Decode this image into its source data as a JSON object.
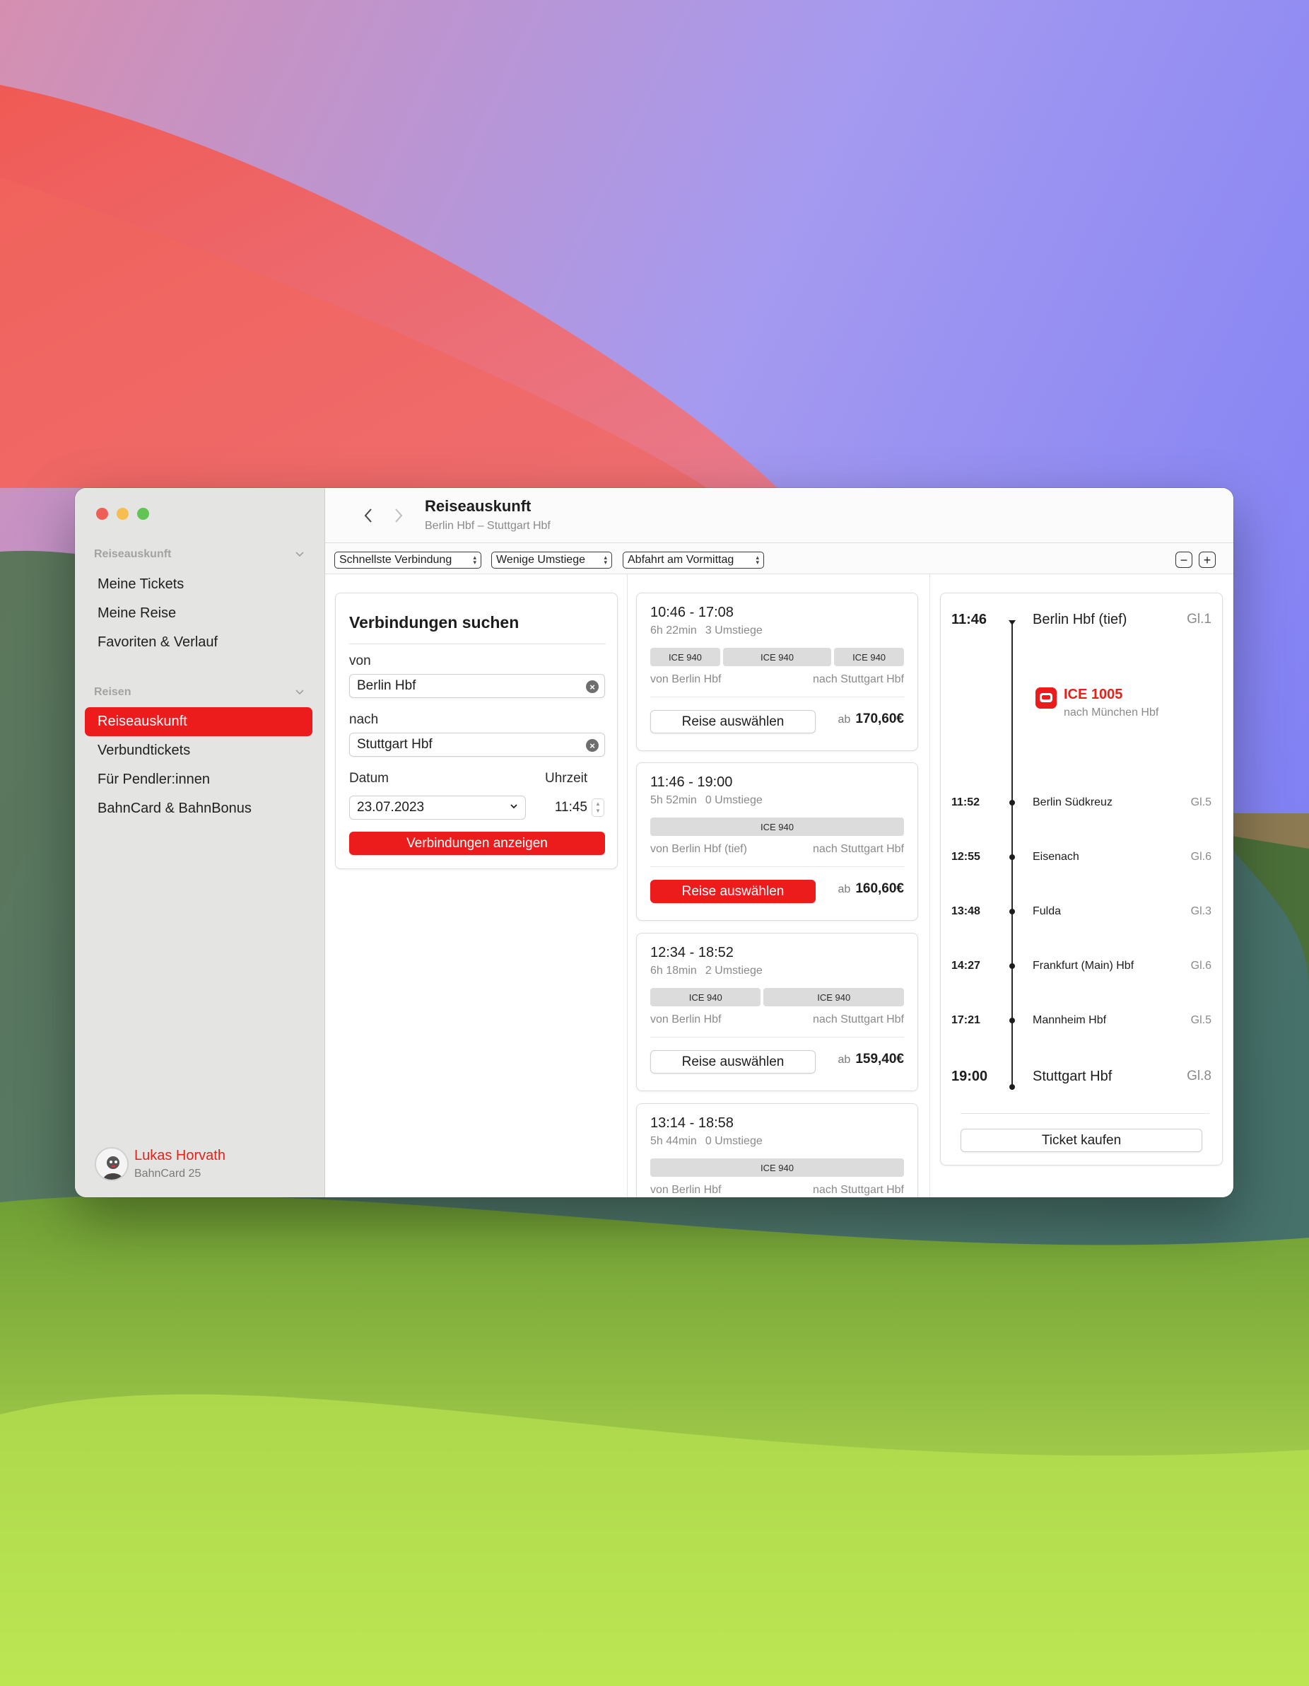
{
  "sidebar": {
    "sections": [
      {
        "title": "Reiseauskunft",
        "items": [
          "Meine Tickets",
          "Meine Reise",
          "Favoriten & Verlauf"
        ]
      },
      {
        "title": "Reisen",
        "items": [
          "Reiseauskunft",
          "Verbundtickets",
          "Für Pendler:innen",
          "BahnCard & BahnBonus"
        ]
      }
    ],
    "active_item": "Reiseauskunft",
    "user": {
      "name": "Lukas Horvath",
      "subtitle": "BahnCard 25"
    }
  },
  "header": {
    "title": "Reiseauskunft",
    "subtitle": "Berlin Hbf – Stuttgart Hbf"
  },
  "filters": [
    "Schnellste Verbindung",
    "Wenige Umstiege",
    "Abfahrt am Vormittag"
  ],
  "search": {
    "title": "Verbindungen suchen",
    "from_label": "von",
    "from_value": "Berlin Hbf",
    "to_label": "nach",
    "to_value": "Stuttgart Hbf",
    "date_label": "Datum",
    "date_value": "23.07.2023",
    "time_label": "Uhrzeit",
    "time_value": "11:45",
    "submit_label": "Verbindungen anzeigen"
  },
  "connections": [
    {
      "time": "10:46 - 17:08",
      "duration": "6h 22min",
      "changes": "3 Umstiege",
      "trains": [
        "ICE 940",
        "ICE 940",
        "ICE 940"
      ],
      "from": "von Berlin Hbf",
      "to": "nach Stuttgart Hbf",
      "button": "Reise auswählen",
      "price_prefix": "ab",
      "price": "170,60€"
    },
    {
      "time": "11:46 - 19:00",
      "duration": "5h 52min",
      "changes": "0 Umstiege",
      "trains": [
        "ICE 940"
      ],
      "from": "von Berlin Hbf (tief)",
      "to": "nach Stuttgart Hbf",
      "button": "Reise auswählen",
      "price_prefix": "ab",
      "price": "160,60€"
    },
    {
      "time": "12:34 - 18:52",
      "duration": "6h 18min",
      "changes": "2 Umstiege",
      "trains": [
        "ICE 940",
        "ICE 940"
      ],
      "from": "von Berlin Hbf",
      "to": "nach Stuttgart Hbf",
      "button": "Reise auswählen",
      "price_prefix": "ab",
      "price": "159,40€"
    },
    {
      "time": "13:14 - 18:58",
      "duration": "5h 44min",
      "changes": "0 Umstiege",
      "trains": [
        "ICE 940"
      ],
      "from": "von Berlin Hbf",
      "to": "nach Stuttgart Hbf"
    }
  ],
  "selected_connection": 1,
  "detail": {
    "train": "ICE 1005",
    "train_direction": "nach München Hbf",
    "stops": [
      {
        "time": "11:46",
        "name": "Berlin Hbf (tief)",
        "platform": "Gl.1"
      },
      {
        "time": "11:52",
        "name": "Berlin Südkreuz",
        "platform": "Gl.5"
      },
      {
        "time": "12:55",
        "name": "Eisenach",
        "platform": "Gl.6"
      },
      {
        "time": "13:48",
        "name": "Fulda",
        "platform": "Gl.3"
      },
      {
        "time": "14:27",
        "name": "Frankfurt (Main) Hbf",
        "platform": "Gl.6"
      },
      {
        "time": "17:21",
        "name": "Mannheim Hbf",
        "platform": "Gl.5"
      },
      {
        "time": "19:00",
        "name": "Stuttgart Hbf",
        "platform": "Gl.8"
      }
    ],
    "buy_label": "Ticket kaufen"
  },
  "colors": {
    "accent": "#ec1c1c",
    "sidebar": "#e4e4e2"
  }
}
